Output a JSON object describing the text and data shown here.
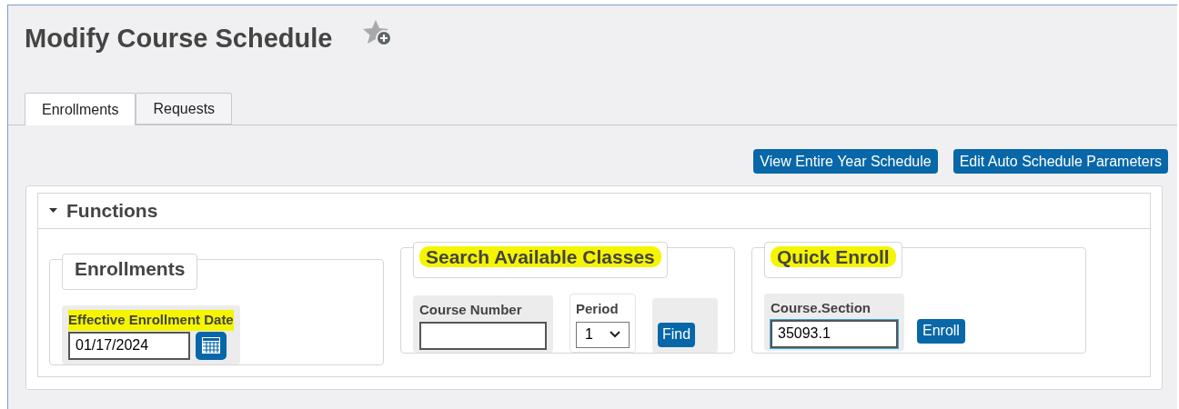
{
  "page": {
    "title": "Modify Course Schedule"
  },
  "tabs": [
    {
      "label": "Enrollments",
      "selected": true
    },
    {
      "label": "Requests",
      "selected": false
    }
  ],
  "action_buttons": [
    "View Entire Year Schedule",
    "Edit Auto Schedule Parameters"
  ],
  "functions": {
    "title": "Functions",
    "expanded": true,
    "groups": [
      {
        "legend": "Enrollments",
        "highlighted": false,
        "fields": [
          {
            "kind": "date",
            "label": "Effective Enrollment Date",
            "highlighted": true,
            "value": "01/17/2024",
            "focused": false
          }
        ]
      },
      {
        "legend": "Search Available Classes",
        "highlighted": true,
        "fields": [
          {
            "kind": "text",
            "label": "Course Number",
            "highlighted": false,
            "focused": false
          },
          {
            "kind": "select",
            "label": "Period",
            "highlighted": false,
            "value": "1"
          },
          {
            "kind": "button",
            "label": "Find",
            "boxed": true
          }
        ]
      },
      {
        "legend": "Quick Enroll",
        "highlighted": true,
        "fields": [
          {
            "kind": "text",
            "label": "Course.Section",
            "highlighted": false,
            "value": "35093.1",
            "focused": true
          },
          {
            "kind": "button",
            "label": "Enroll",
            "boxed": false
          }
        ]
      }
    ]
  }
}
